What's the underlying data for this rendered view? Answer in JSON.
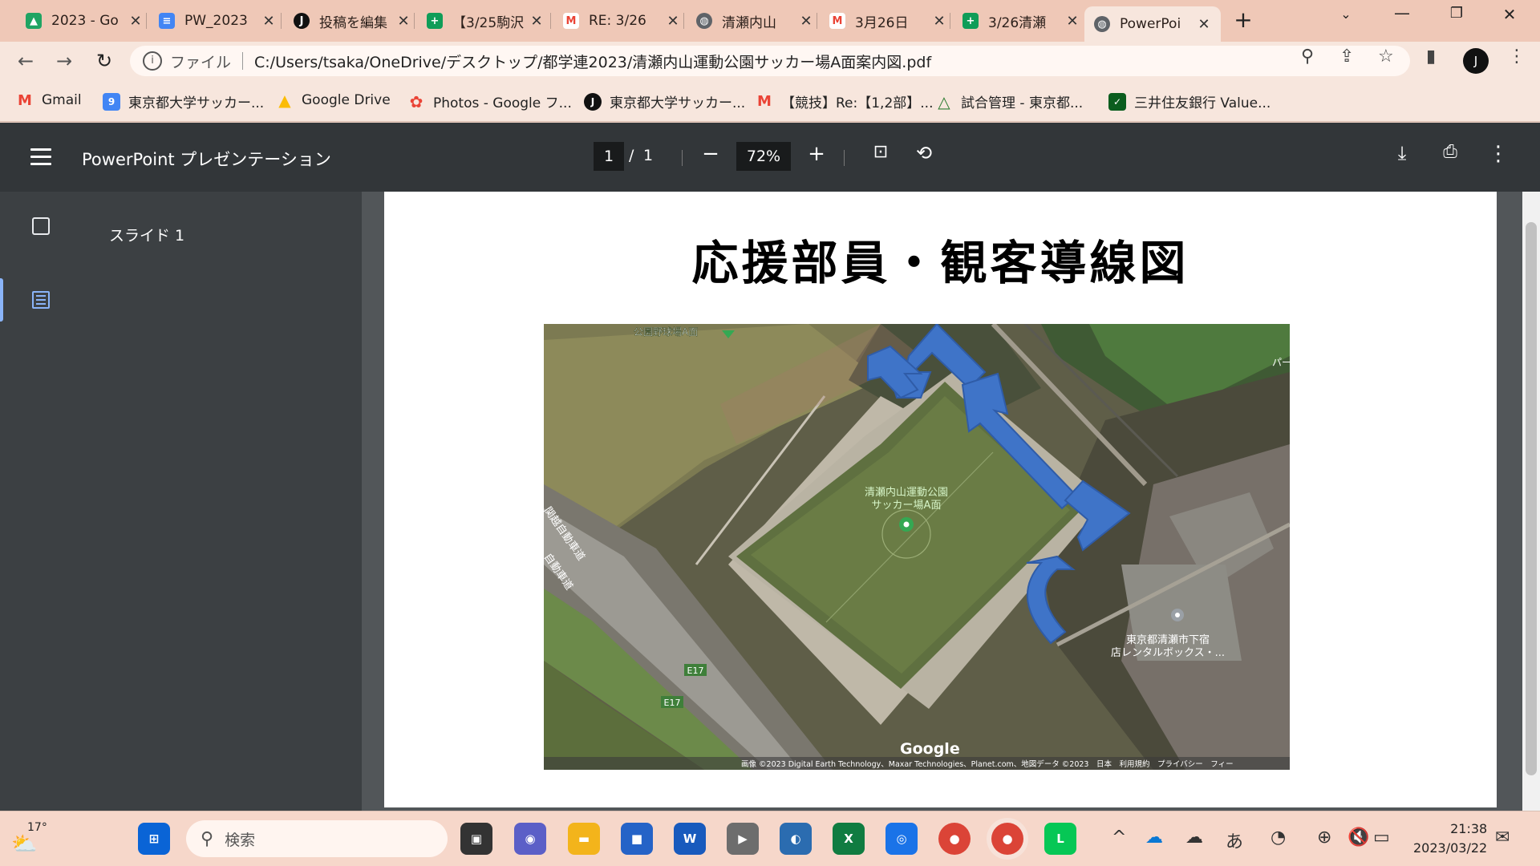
{
  "browser": {
    "tabs": [
      {
        "label": "2023 - Go",
        "icon": "google-drive-icon",
        "color": "#1fa463"
      },
      {
        "label": "PW_2023",
        "icon": "google-docs-icon",
        "color": "#4285f4"
      },
      {
        "label": "投稿を編集",
        "icon": "jt-logo-icon",
        "color": "#111111"
      },
      {
        "label": "【3/25駒沢",
        "icon": "google-sheets-icon",
        "color": "#0f9d58"
      },
      {
        "label": "RE: 3/26",
        "icon": "gmail-icon",
        "color": "#ea4335"
      },
      {
        "label": "清瀬内山",
        "icon": "globe-icon",
        "color": "#5f6368"
      },
      {
        "label": "3月26日",
        "icon": "gmail-icon",
        "color": "#ea4335"
      },
      {
        "label": "3/26清瀬",
        "icon": "google-sheets-icon",
        "color": "#0f9d58"
      },
      {
        "label": "PowerPoi",
        "icon": "globe-icon",
        "color": "#5f6368",
        "active": true
      }
    ],
    "new_tab": "+",
    "address": {
      "scheme": "ファイル",
      "url": "C:/Users/tsaka/OneDrive/デスクトップ/都学連2023/清瀬内山運動公園サッカー場A面案内図.pdf"
    },
    "bookmarks": [
      {
        "label": "Gmail",
        "icon": "gmail-icon",
        "color": "#ea4335"
      },
      {
        "label": "東京都大学サッカー...",
        "icon": "calendar-icon",
        "color": "#4285f4"
      },
      {
        "label": "Google Drive",
        "icon": "google-drive-icon",
        "color": "#fbbc04"
      },
      {
        "label": "Photos - Google フ...",
        "icon": "google-photos-icon",
        "color": "#ea4335"
      },
      {
        "label": "東京都大学サッカー...",
        "icon": "jt-logo-icon",
        "color": "#111111"
      },
      {
        "label": "【競技】Re:【1,2部】...",
        "icon": "gmail-icon",
        "color": "#ea4335"
      },
      {
        "label": "試合管理 - 東京都...",
        "icon": "triangle-logo-icon",
        "color": "#2e7d32"
      },
      {
        "label": "三井住友銀行 Value...",
        "icon": "smbc-icon",
        "color": "#0b5d1e"
      }
    ]
  },
  "pdf": {
    "title": "PowerPoint プレゼンテーション",
    "page_current": "1",
    "page_separator": "/",
    "page_total": "1",
    "zoom": "72%",
    "sidebar_item": "スライド 1",
    "slide_title": "応援部員・観客導線図",
    "map": {
      "labels": {
        "baseball": "公園野球場A面",
        "field_line1": "清瀬内山運動公園",
        "field_line2": "サッカー場A面",
        "address_line1": "東京都清瀬市下宿",
        "address_line2": "店レンタルボックス・...",
        "expressway1": "関越自動車道",
        "expressway2": "自動車道",
        "route1": "E17",
        "route2": "E17",
        "park_edge": "パー",
        "google": "Google",
        "attribution": "画像 ©2023 Digital Earth Technology、Maxar Technologies、Planet.com、地図データ ©2023　日本　利用規約　プライバシー　フィー"
      }
    }
  },
  "taskbar": {
    "weather_temp": "17°",
    "search_placeholder": "検索",
    "ime": "あ",
    "time": "21:38",
    "date": "2023/03/22"
  }
}
